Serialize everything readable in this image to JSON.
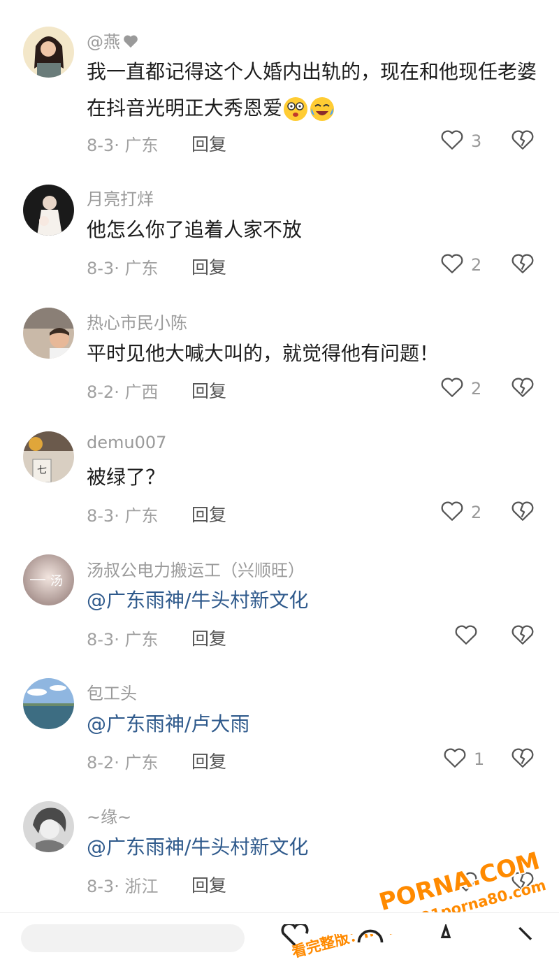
{
  "comments": [
    {
      "username": "@燕",
      "has_heart_badge": true,
      "text_parts": [
        "我一直都记得这个人婚内出轨的，现在和他现任老婆在抖音光明正大秀恩爱"
      ],
      "emojis": [
        "shocked-emoji",
        "laughing-crying-emoji"
      ],
      "date": "8-3",
      "region": "广东",
      "reply": "回复",
      "likes": "3"
    },
    {
      "username": "月亮打烊",
      "text_parts": [
        "他怎么你了追着人家不放"
      ],
      "date": "8-3",
      "region": "广东",
      "reply": "回复",
      "likes": "2"
    },
    {
      "username": "热心市民小陈",
      "text_parts": [
        "平时见他大喊大叫的，就觉得他有问题！"
      ],
      "date": "8-2",
      "region": "广西",
      "reply": "回复",
      "likes": "2"
    },
    {
      "username": "demu007",
      "text_parts": [
        "被绿了？"
      ],
      "date": "8-3",
      "region": "广东",
      "reply": "回复",
      "likes": "2"
    },
    {
      "username": "汤叔公电力搬运工（兴顺旺）",
      "mention": "@广东雨神/牛头村新文化",
      "date": "8-3",
      "region": "广东",
      "reply": "回复",
      "likes": ""
    },
    {
      "username": "包工头",
      "mention": "@广东雨神/卢大雨",
      "date": "8-2",
      "region": "广东",
      "reply": "回复",
      "likes": "1"
    },
    {
      "username": "~缘~",
      "mention": "@广东雨神/牛头村新文化",
      "date": "8-3",
      "region": "浙江",
      "reply": "回复",
      "likes": ""
    }
  ],
  "watermark": {
    "brand": "PORNA.COM",
    "line": "看完整版：https://91porna80.com"
  },
  "colors": {
    "mention": "#2f5a8c",
    "meta": "#a0a0a0",
    "watermark": "#ff8a00"
  }
}
